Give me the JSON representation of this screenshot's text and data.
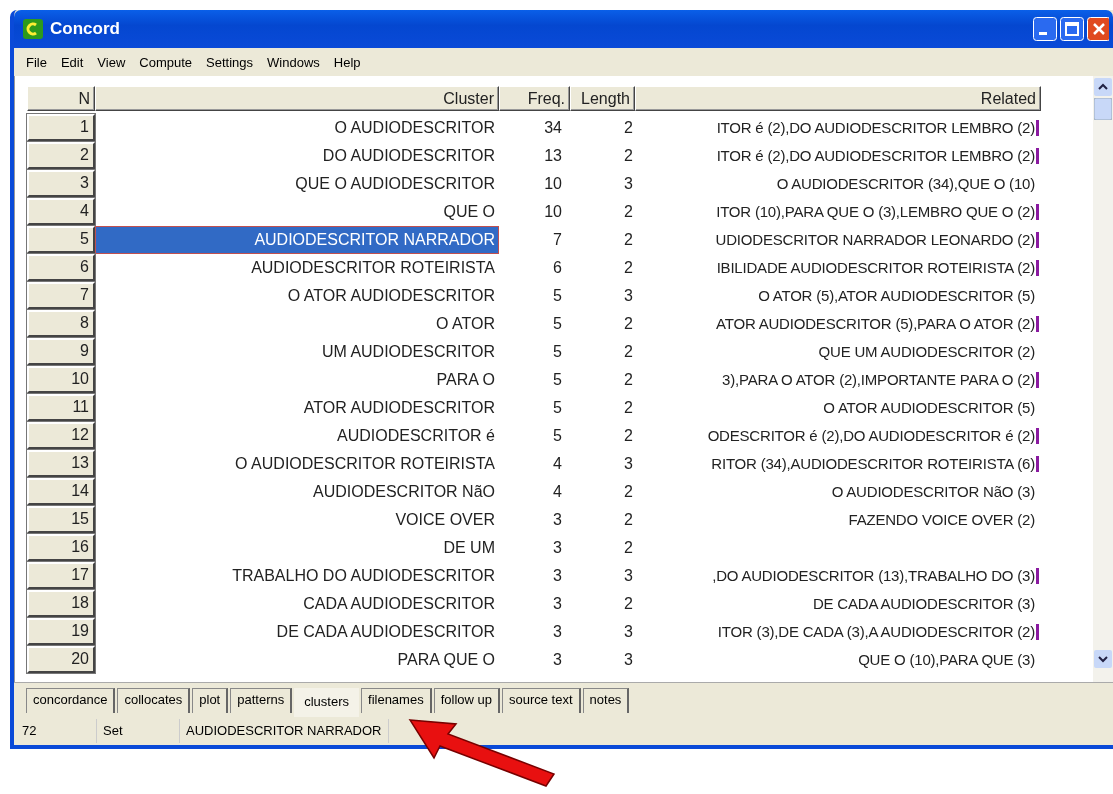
{
  "window": {
    "title": "Concord"
  },
  "menu": [
    "File",
    "Edit",
    "View",
    "Compute",
    "Settings",
    "Windows",
    "Help"
  ],
  "table": {
    "columns": [
      "N",
      "Cluster",
      "Freq.",
      "Length",
      "Related"
    ],
    "rows": [
      {
        "n": "1",
        "cluster": "O AUDIODESCRITOR",
        "freq": "34",
        "length": "2",
        "related": "ITOR é (2),DO AUDIODESCRITOR LEMBRO (2)",
        "marked": true,
        "selected": false
      },
      {
        "n": "2",
        "cluster": "DO AUDIODESCRITOR",
        "freq": "13",
        "length": "2",
        "related": "ITOR é (2),DO AUDIODESCRITOR LEMBRO (2)",
        "marked": true,
        "selected": false
      },
      {
        "n": "3",
        "cluster": "QUE O AUDIODESCRITOR",
        "freq": "10",
        "length": "3",
        "related": "O AUDIODESCRITOR (34),QUE O (10)",
        "marked": false,
        "selected": false
      },
      {
        "n": "4",
        "cluster": "QUE O",
        "freq": "10",
        "length": "2",
        "related": "ITOR (10),PARA QUE O (3),LEMBRO QUE O (2)",
        "marked": true,
        "selected": false
      },
      {
        "n": "5",
        "cluster": "AUDIODESCRITOR NARRADOR",
        "freq": "7",
        "length": "2",
        "related": "UDIODESCRITOR NARRADOR LEONARDO (2)",
        "marked": true,
        "selected": true
      },
      {
        "n": "6",
        "cluster": "AUDIODESCRITOR ROTEIRISTA",
        "freq": "6",
        "length": "2",
        "related": "IBILIDADE AUDIODESCRITOR ROTEIRISTA (2)",
        "marked": true,
        "selected": false
      },
      {
        "n": "7",
        "cluster": "O ATOR AUDIODESCRITOR",
        "freq": "5",
        "length": "3",
        "related": "O ATOR (5),ATOR AUDIODESCRITOR (5)",
        "marked": false,
        "selected": false
      },
      {
        "n": "8",
        "cluster": "O ATOR",
        "freq": "5",
        "length": "2",
        "related": "ATOR AUDIODESCRITOR (5),PARA O ATOR (2)",
        "marked": true,
        "selected": false
      },
      {
        "n": "9",
        "cluster": "UM AUDIODESCRITOR",
        "freq": "5",
        "length": "2",
        "related": "QUE UM AUDIODESCRITOR (2)",
        "marked": false,
        "selected": false
      },
      {
        "n": "10",
        "cluster": "PARA O",
        "freq": "5",
        "length": "2",
        "related": "3),PARA O ATOR (2),IMPORTANTE PARA O (2)",
        "marked": true,
        "selected": false
      },
      {
        "n": "11",
        "cluster": "ATOR AUDIODESCRITOR",
        "freq": "5",
        "length": "2",
        "related": "O ATOR AUDIODESCRITOR (5)",
        "marked": false,
        "selected": false
      },
      {
        "n": "12",
        "cluster": "AUDIODESCRITOR é",
        "freq": "5",
        "length": "2",
        "related": "ODESCRITOR é (2),DO AUDIODESCRITOR é (2)",
        "marked": true,
        "selected": false
      },
      {
        "n": "13",
        "cluster": "O AUDIODESCRITOR ROTEIRISTA",
        "freq": "4",
        "length": "3",
        "related": "RITOR (34),AUDIODESCRITOR ROTEIRISTA (6)",
        "marked": true,
        "selected": false
      },
      {
        "n": "14",
        "cluster": "AUDIODESCRITOR NãO",
        "freq": "4",
        "length": "2",
        "related": "O AUDIODESCRITOR NãO (3)",
        "marked": false,
        "selected": false
      },
      {
        "n": "15",
        "cluster": "VOICE OVER",
        "freq": "3",
        "length": "2",
        "related": "FAZENDO VOICE OVER (2)",
        "marked": false,
        "selected": false
      },
      {
        "n": "16",
        "cluster": "DE UM",
        "freq": "3",
        "length": "2",
        "marked": false,
        "selected": false
      },
      {
        "n": "17",
        "cluster": "TRABALHO DO AUDIODESCRITOR",
        "freq": "3",
        "length": "3",
        "related": ",DO AUDIODESCRITOR (13),TRABALHO DO (3)",
        "marked": true,
        "selected": false
      },
      {
        "n": "18",
        "cluster": "CADA AUDIODESCRITOR",
        "freq": "3",
        "length": "2",
        "related": "DE CADA AUDIODESCRITOR (3)",
        "marked": false,
        "selected": false
      },
      {
        "n": "19",
        "cluster": "DE CADA AUDIODESCRITOR",
        "freq": "3",
        "length": "3",
        "related": "ITOR (3),DE CADA (3),A AUDIODESCRITOR (2)",
        "marked": true,
        "selected": false
      },
      {
        "n": "20",
        "cluster": "PARA QUE O",
        "freq": "3",
        "length": "3",
        "related": "QUE O (10),PARA QUE (3)",
        "marked": false,
        "selected": false
      }
    ]
  },
  "tabs": [
    {
      "label": "concordance",
      "selected": false
    },
    {
      "label": "collocates",
      "selected": false
    },
    {
      "label": "plot",
      "selected": false
    },
    {
      "label": "patterns",
      "selected": false
    },
    {
      "label": "clusters",
      "selected": true
    },
    {
      "label": "filenames",
      "selected": false
    },
    {
      "label": "follow up",
      "selected": false
    },
    {
      "label": "source text",
      "selected": false
    },
    {
      "label": "notes",
      "selected": false
    }
  ],
  "status_bar": [
    "72",
    "Set",
    "AUDIODESCRITOR NARRADOR"
  ]
}
